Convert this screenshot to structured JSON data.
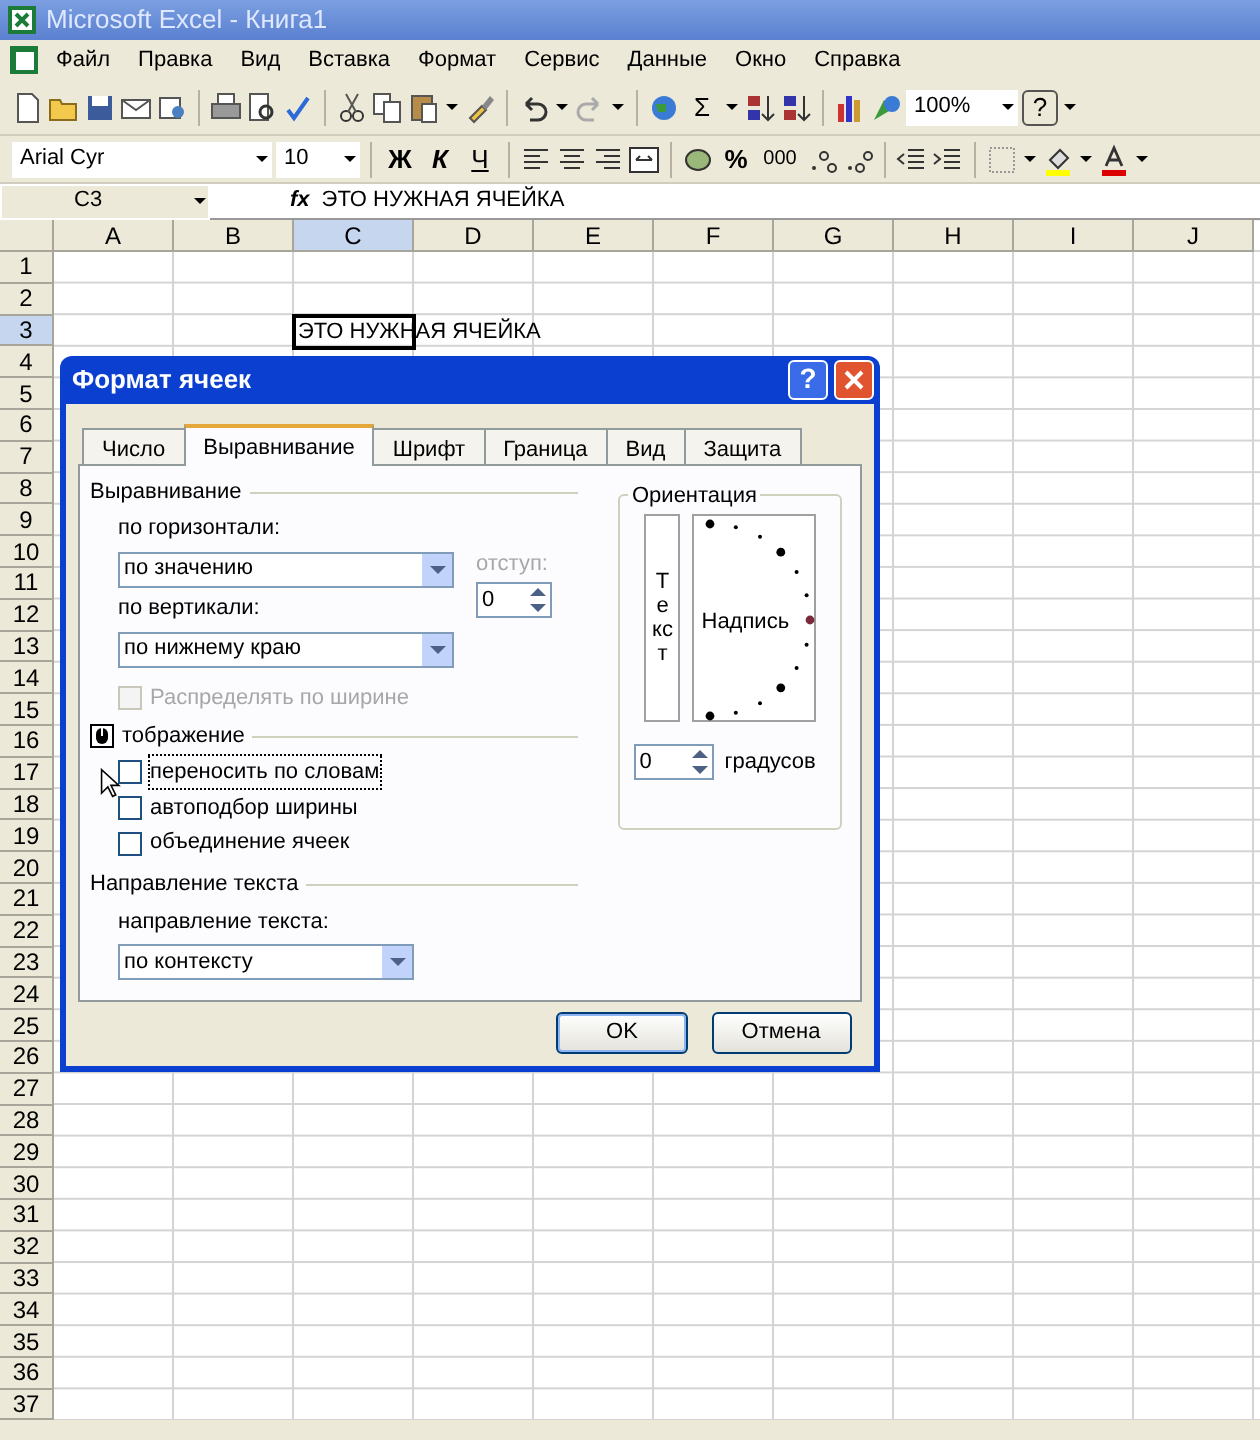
{
  "window": {
    "title": "Microsoft Excel - Книга1"
  },
  "menu": [
    "Файл",
    "Правка",
    "Вид",
    "Вставка",
    "Формат",
    "Сервис",
    "Данные",
    "Окно",
    "Справка"
  ],
  "toolbar": {
    "sum": "Σ",
    "zoom": "100%",
    "help": "?",
    "font": "Arial Cyr",
    "size": "10",
    "bold": "Ж",
    "italic": "К",
    "underline": "Ч",
    "percent": "%",
    "thousands": "000"
  },
  "formula_bar": {
    "name_box": "C3",
    "fx": "fx",
    "value": "ЭТО НУЖНАЯ ЯЧЕЙКА"
  },
  "sheet": {
    "columns": [
      {
        "label": "A",
        "selected": false
      },
      {
        "label": "B",
        "selected": false
      },
      {
        "label": "C",
        "selected": true
      },
      {
        "label": "D",
        "selected": false
      },
      {
        "label": "E",
        "selected": false
      },
      {
        "label": "F",
        "selected": false
      },
      {
        "label": "G",
        "selected": false
      },
      {
        "label": "H",
        "selected": false
      },
      {
        "label": "I",
        "selected": false
      },
      {
        "label": "J",
        "selected": false
      }
    ],
    "rows": [
      {
        "label": "1",
        "selected": false
      },
      {
        "label": "2",
        "selected": false
      },
      {
        "label": "3",
        "selected": true
      },
      {
        "label": "4",
        "selected": false
      },
      {
        "label": "5",
        "selected": false
      },
      {
        "label": "6",
        "selected": false
      },
      {
        "label": "7",
        "selected": false
      },
      {
        "label": "8",
        "selected": false
      },
      {
        "label": "9",
        "selected": false
      },
      {
        "label": "10",
        "selected": false
      },
      {
        "label": "11",
        "selected": false
      },
      {
        "label": "12",
        "selected": false
      },
      {
        "label": "13",
        "selected": false
      },
      {
        "label": "14",
        "selected": false
      },
      {
        "label": "15",
        "selected": false
      },
      {
        "label": "16",
        "selected": false
      },
      {
        "label": "17",
        "selected": false
      },
      {
        "label": "18",
        "selected": false
      },
      {
        "label": "19",
        "selected": false
      },
      {
        "label": "20",
        "selected": false
      },
      {
        "label": "21",
        "selected": false
      },
      {
        "label": "22",
        "selected": false
      },
      {
        "label": "23",
        "selected": false
      },
      {
        "label": "24",
        "selected": false
      },
      {
        "label": "25",
        "selected": false
      },
      {
        "label": "26",
        "selected": false
      },
      {
        "label": "27",
        "selected": false
      },
      {
        "label": "28",
        "selected": false
      },
      {
        "label": "29",
        "selected": false
      },
      {
        "label": "30",
        "selected": false
      },
      {
        "label": "31",
        "selected": false
      },
      {
        "label": "32",
        "selected": false
      },
      {
        "label": "33",
        "selected": false
      },
      {
        "label": "34",
        "selected": false
      },
      {
        "label": "35",
        "selected": false
      },
      {
        "label": "36",
        "selected": false
      },
      {
        "label": "37",
        "selected": false
      }
    ],
    "active_cell": {
      "text": "ЭТО НУЖНАЯ ЯЧЕЙКА"
    }
  },
  "dialog": {
    "title": "Формат ячеек",
    "help": "?",
    "tabs": [
      {
        "label": "Число",
        "selected": false
      },
      {
        "label": "Выравнивание",
        "selected": true
      },
      {
        "label": "Шрифт",
        "selected": false
      },
      {
        "label": "Граница",
        "selected": false
      },
      {
        "label": "Вид",
        "selected": false
      },
      {
        "label": "Защита",
        "selected": false
      }
    ],
    "alignment": {
      "legend": "Выравнивание",
      "horizontal_label": "по горизонтали:",
      "horizontal_value": "по значению",
      "vertical_label": "по вертикали:",
      "vertical_value": "по нижнему краю",
      "indent_label": "отступ:",
      "indent_disabled": true,
      "indent_value": "0",
      "distribute": {
        "label": "Распределять по ширине",
        "checked": false,
        "disabled": true
      }
    },
    "orientation": {
      "legend": "Ориентация",
      "vertical_text": "Текст",
      "sample": "Надпись",
      "degrees_value": "0",
      "degrees_label": "градусов"
    },
    "display": {
      "legend": "тображение",
      "options": [
        {
          "label": "переносить по словам",
          "checked": false,
          "focused": true
        },
        {
          "label": "автоподбор ширины",
          "checked": false,
          "focused": false
        },
        {
          "label": "объединение ячеек",
          "checked": false,
          "focused": false
        }
      ]
    },
    "text_direction": {
      "legend": "Направление текста",
      "label": "направление текста:",
      "value": "по контексту"
    },
    "buttons": [
      {
        "label": "OK",
        "default": true
      },
      {
        "label": "Отмена",
        "default": false
      }
    ]
  }
}
